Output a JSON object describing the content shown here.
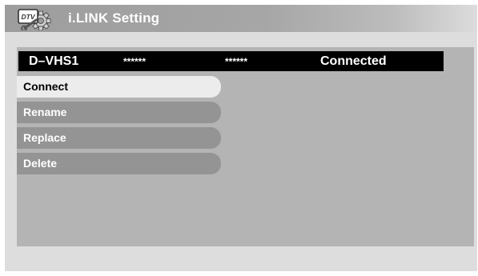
{
  "window": {
    "title": "i.LINK Setting",
    "icon_name": "dtv-gear-icon",
    "icon_label": "DTV"
  },
  "device": {
    "name": "D–VHS1",
    "field1": "******",
    "field2": "******",
    "status": "Connected"
  },
  "menu": {
    "items": [
      {
        "label": "Connect",
        "selected": true
      },
      {
        "label": "Rename",
        "selected": false
      },
      {
        "label": "Replace",
        "selected": false
      },
      {
        "label": "Delete",
        "selected": false
      }
    ]
  },
  "colors": {
    "selected_item": "#ececec",
    "menu_item": "#949494",
    "panel": "#b4b4b4",
    "device_row": "#000000"
  }
}
